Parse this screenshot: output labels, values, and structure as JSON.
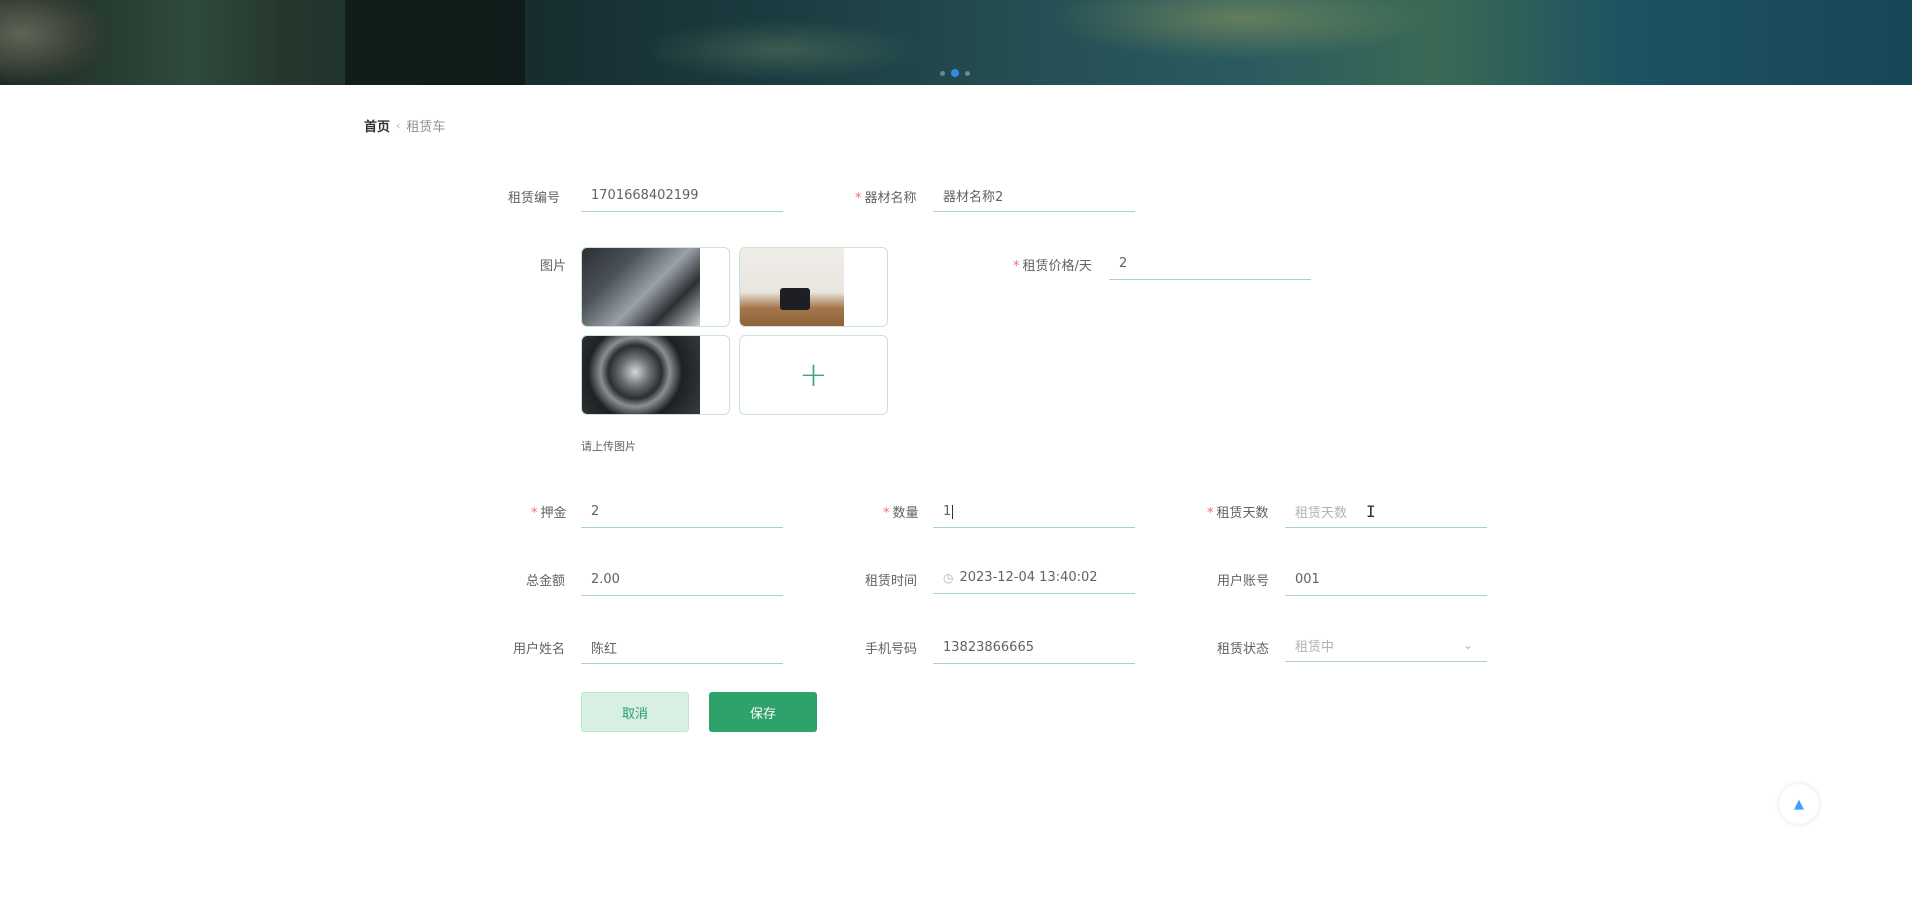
{
  "breadcrumb": {
    "home": "首页",
    "separator": "‹",
    "current": "租赁车"
  },
  "form": {
    "rental_no": {
      "label": "租赁编号",
      "value": "1701668402199"
    },
    "equipment_name": {
      "required": "*",
      "label": "器材名称",
      "value": "器材名称2"
    },
    "image": {
      "label": "图片",
      "hint": "请上传图片",
      "add_icon": "plus-icon"
    },
    "price_per_day": {
      "required": "*",
      "label": "租赁价格/天",
      "value": "2"
    },
    "deposit": {
      "required": "*",
      "label": "押金",
      "value": "2"
    },
    "quantity": {
      "required": "*",
      "label": "数量",
      "value": "1"
    },
    "rental_days": {
      "required": "*",
      "label": "租赁天数",
      "placeholder": "租赁天数"
    },
    "total_amount": {
      "label": "总金额",
      "value": "2.00"
    },
    "rental_time": {
      "label": "租赁时间",
      "value": "2023-12-04 13:40:02",
      "icon": "clock-icon"
    },
    "user_account": {
      "label": "用户账号",
      "value": "001"
    },
    "user_name": {
      "label": "用户姓名",
      "value": "陈红"
    },
    "phone": {
      "label": "手机号码",
      "value": "13823866665"
    },
    "rental_status": {
      "label": "租赁状态",
      "value": "租赁中",
      "icon": "chevron-down-icon"
    }
  },
  "buttons": {
    "cancel": "取消",
    "save": "保存"
  },
  "colors": {
    "accent": "#2ea26a",
    "required": "#f56c6c",
    "active_dot": "#2f8ce6"
  }
}
